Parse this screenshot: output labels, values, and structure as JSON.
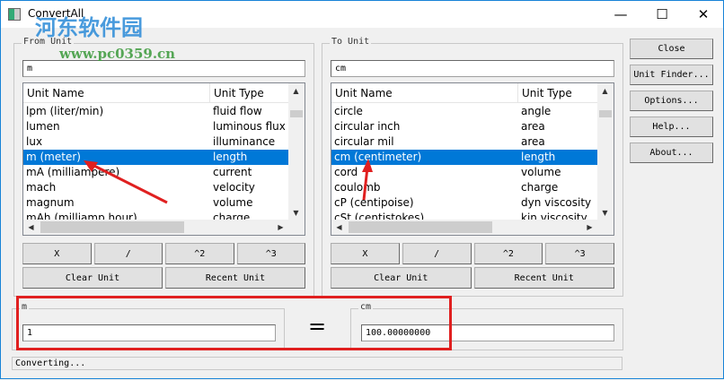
{
  "window": {
    "title": "ConvertAll",
    "min": "—",
    "max": "☐",
    "close": "✕"
  },
  "watermark": {
    "site_name": "河东软件园",
    "url": "www.pc0359.cn"
  },
  "from": {
    "label": "From Unit",
    "filter": "m",
    "col_name": "Unit Name",
    "col_type": "Unit Type",
    "rows": [
      [
        "lpm  (liter/min)",
        "fluid flow"
      ],
      [
        "lumen",
        "luminous flux"
      ],
      [
        "lux",
        "illuminance"
      ],
      [
        "m  (meter)",
        "length"
      ],
      [
        "mA  (milliampere)",
        "current"
      ],
      [
        "mach",
        "velocity"
      ],
      [
        "magnum",
        "volume"
      ],
      [
        "mAh  (milliamp hour)",
        "charge"
      ]
    ],
    "selected": 3
  },
  "to": {
    "label": "To Unit",
    "filter": "cm",
    "col_name": "Unit Name",
    "col_type": "Unit Type",
    "rows": [
      [
        "circle",
        "angle"
      ],
      [
        "circular inch",
        "area"
      ],
      [
        "circular mil",
        "area"
      ],
      [
        "cm  (centimeter)",
        "length"
      ],
      [
        "cord",
        "volume"
      ],
      [
        "coulomb",
        "charge"
      ],
      [
        "cP  (centipoise)",
        "dyn viscosity"
      ],
      [
        "cSt  (centistokes)",
        "kin viscosity"
      ]
    ],
    "selected": 3
  },
  "ops": {
    "mult": "X",
    "div": "/",
    "sq": "^2",
    "cube": "^3",
    "clear": "Clear Unit",
    "recent": "Recent Unit"
  },
  "side": {
    "close": "Close",
    "finder": "Unit Finder...",
    "options": "Options...",
    "help": "Help...",
    "about": "About..."
  },
  "result": {
    "from_label": "m",
    "from_value": "1",
    "equals": "=",
    "to_label": "cm",
    "to_value": "100.00000000"
  },
  "status": "Converting...",
  "colors": {
    "highlight": "#0078d7",
    "annotation": "#e02020"
  }
}
